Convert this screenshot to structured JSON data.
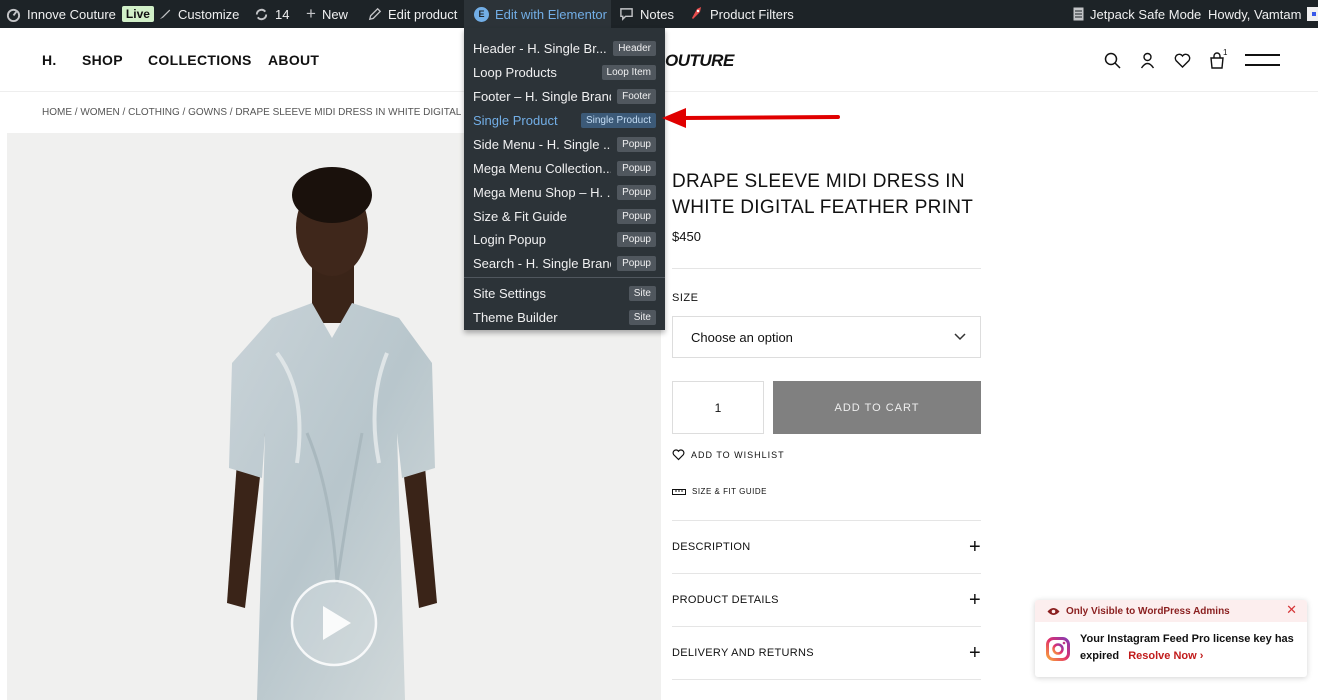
{
  "admin_bar": {
    "site_name": "Innove Couture",
    "live_badge": "Live",
    "customize": "Customize",
    "updates_count": "14",
    "new": "New",
    "edit_product": "Edit product",
    "edit_elementor": "Edit with Elementor",
    "notes": "Notes",
    "product_filters": "Product Filters",
    "jetpack": "Jetpack Safe Mode",
    "howdy": "Howdy, Vamtam"
  },
  "elementor_menu": {
    "items": [
      {
        "label": "Header - H. Single Br...",
        "badge": "Header"
      },
      {
        "label": "Loop Products",
        "badge": "Loop Item"
      },
      {
        "label": "Footer – H. Single Brand",
        "badge": "Footer"
      },
      {
        "label": "Single Product",
        "badge": "Single Product"
      },
      {
        "label": "Side Menu - H. Single ...",
        "badge": "Popup"
      },
      {
        "label": "Mega Menu Collection...",
        "badge": "Popup"
      },
      {
        "label": "Mega Menu Shop – H. ...",
        "badge": "Popup"
      },
      {
        "label": "Size & Fit Guide",
        "badge": "Popup"
      },
      {
        "label": "Login Popup",
        "badge": "Popup"
      },
      {
        "label": "Search - H. Single Brand",
        "badge": "Popup"
      },
      {
        "label": "Site Settings",
        "badge": "Site"
      },
      {
        "label": "Theme Builder",
        "badge": "Site"
      }
    ]
  },
  "header": {
    "nav": [
      "H.",
      "SHOP",
      "COLLECTIONS",
      "ABOUT"
    ],
    "logo_text": "OUTURE",
    "cart_count": "1"
  },
  "breadcrumb": {
    "text": "HOME / WOMEN / CLOTHING / GOWNS / DRAPE SLEEVE MIDI DRESS IN WHITE DIGITAL FEA"
  },
  "product": {
    "title": "DRAPE SLEEVE MIDI DRESS IN WHITE DIGITAL FEATHER PRINT",
    "price": "$450",
    "size_label": "SIZE",
    "size_placeholder": "Choose an option",
    "quantity": "1",
    "add_to_cart": "ADD TO CART",
    "wishlist": "ADD TO WISHLIST",
    "size_fit": "SIZE & FIT GUIDE",
    "accordions": [
      "DESCRIPTION",
      "PRODUCT DETAILS",
      "DELIVERY AND RETURNS"
    ]
  },
  "notice": {
    "header": "Only Visible to WordPress Admins",
    "message": "Your Instagram Feed Pro license key has expired",
    "link": "Resolve Now"
  },
  "colors": {
    "admin_bar": "#1d2327",
    "menu_bg": "#2c3338",
    "active_link": "#72aee6",
    "arrow": "#e00000",
    "add_to_cart_bg": "#808080"
  }
}
